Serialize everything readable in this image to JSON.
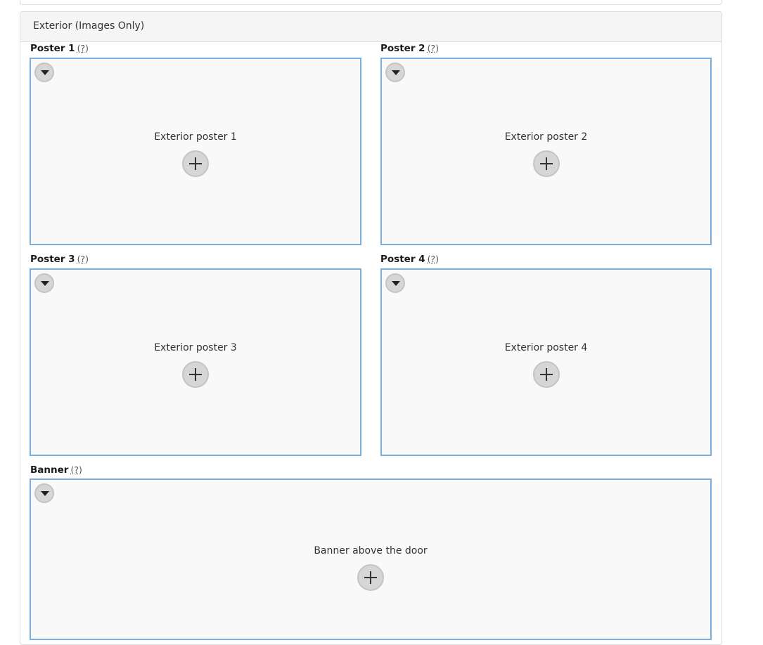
{
  "section": {
    "title": "Exterior (Images Only)"
  },
  "help_marker": "(?)",
  "fields": [
    {
      "label": "Poster 1",
      "placeholder": "Exterior poster 1"
    },
    {
      "label": "Poster 2",
      "placeholder": "Exterior poster 2"
    },
    {
      "label": "Poster 3",
      "placeholder": "Exterior poster 3"
    },
    {
      "label": "Poster 4",
      "placeholder": "Exterior poster 4"
    },
    {
      "label": "Banner",
      "placeholder": "Banner above the door"
    }
  ],
  "icons": {
    "menu": "caret-down-icon",
    "add": "plus-icon"
  },
  "colors": {
    "dropzone_border": "#7aaedd",
    "dropzone_bg": "#f9f9f9",
    "heading_bg": "#f5f5f5"
  }
}
